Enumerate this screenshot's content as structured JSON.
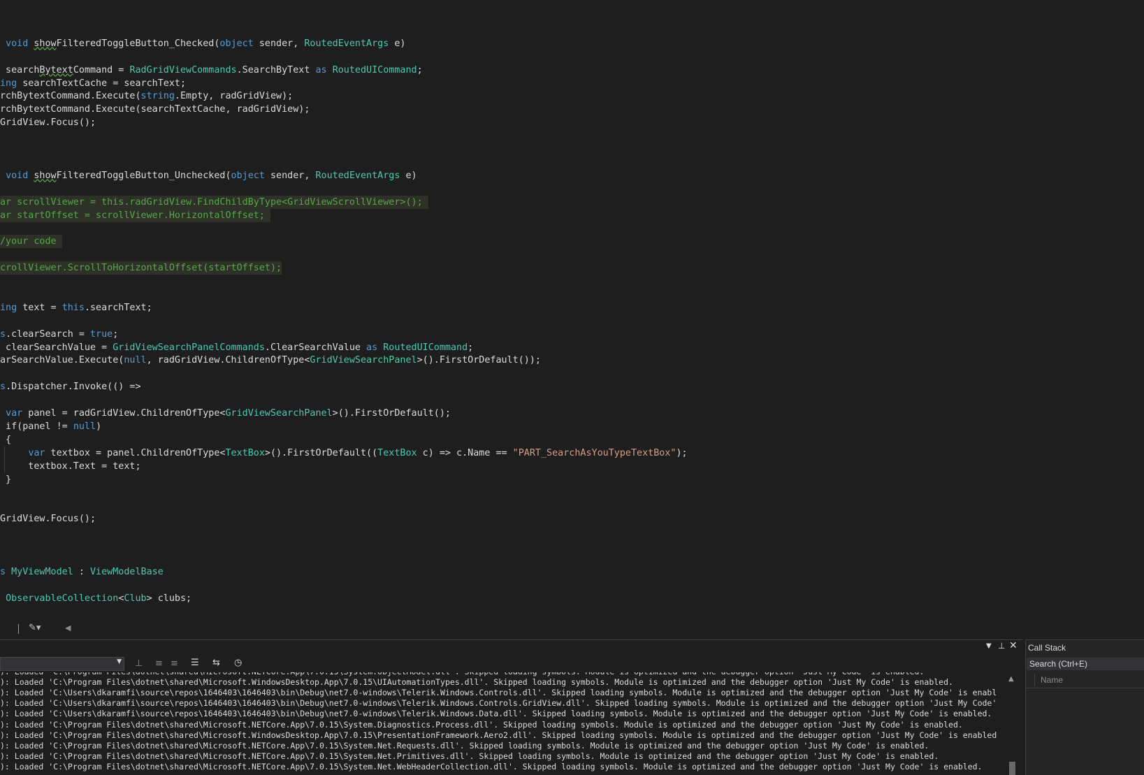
{
  "code_lines": [
    {
      "hl": false,
      "segs": []
    },
    {
      "hl": false,
      "segs": []
    },
    {
      "hl": false,
      "segs": [
        [
          "plain",
          " "
        ],
        [
          "kw",
          "void"
        ],
        [
          "plain",
          " "
        ],
        [
          "squig",
          "show"
        ],
        [
          "plain",
          "FilteredToggleButton_Checked("
        ],
        [
          "kw",
          "object"
        ],
        [
          "plain",
          " sender, "
        ],
        [
          "type",
          "RoutedEventArgs"
        ],
        [
          "plain",
          " e)"
        ]
      ]
    },
    {
      "hl": false,
      "segs": []
    },
    {
      "hl": false,
      "segs": [
        [
          "plain",
          " search"
        ],
        [
          "squig",
          "Bytext"
        ],
        [
          "plain",
          "Command = "
        ],
        [
          "type",
          "RadGridViewCommands"
        ],
        [
          "plain",
          ".SearchByText "
        ],
        [
          "kw",
          "as"
        ],
        [
          "plain",
          " "
        ],
        [
          "type",
          "RoutedUICommand"
        ],
        [
          "plain",
          ";"
        ]
      ]
    },
    {
      "hl": false,
      "segs": [
        [
          "kw",
          "ing"
        ],
        [
          "plain",
          " searchTextCache = searchText;"
        ]
      ]
    },
    {
      "hl": false,
      "segs": [
        [
          "plain",
          "rchBytextCommand.Execute("
        ],
        [
          "kw",
          "string"
        ],
        [
          "plain",
          ".Empty, radGridView);"
        ]
      ]
    },
    {
      "hl": false,
      "segs": [
        [
          "plain",
          "rchBytextCommand.Execute(searchTextCache, radGridView);"
        ]
      ]
    },
    {
      "hl": false,
      "segs": [
        [
          "plain",
          "GridView.Focus();"
        ]
      ]
    },
    {
      "hl": false,
      "segs": []
    },
    {
      "hl": false,
      "segs": []
    },
    {
      "hl": false,
      "segs": []
    },
    {
      "hl": false,
      "segs": [
        [
          "plain",
          " "
        ],
        [
          "kw",
          "void"
        ],
        [
          "plain",
          " "
        ],
        [
          "squig",
          "show"
        ],
        [
          "plain",
          "FilteredToggleButton_Unchecked("
        ],
        [
          "kw",
          "object"
        ],
        [
          "plain",
          " sender, "
        ],
        [
          "type",
          "RoutedEventArgs"
        ],
        [
          "plain",
          " e)"
        ]
      ]
    },
    {
      "hl": false,
      "segs": []
    },
    {
      "hl": true,
      "segs": [
        [
          "cm",
          "ar scrollViewer = this.radGridView.FindChildByType<GridViewScrollViewer>(); "
        ]
      ]
    },
    {
      "hl": true,
      "segs": [
        [
          "cm",
          "ar startOffset = scrollViewer.HorizontalOffset; "
        ]
      ]
    },
    {
      "hl": false,
      "segs": []
    },
    {
      "hl": true,
      "segs": [
        [
          "cm",
          "/your code "
        ]
      ]
    },
    {
      "hl": false,
      "segs": []
    },
    {
      "hl": true,
      "segs": [
        [
          "cm",
          "crollViewer.ScrollToHorizontalOffset(startOffset);"
        ]
      ]
    },
    {
      "hl": false,
      "segs": []
    },
    {
      "hl": false,
      "segs": []
    },
    {
      "hl": false,
      "segs": [
        [
          "kw",
          "ing"
        ],
        [
          "plain",
          " text = "
        ],
        [
          "kw",
          "this"
        ],
        [
          "plain",
          ".searchText;"
        ]
      ]
    },
    {
      "hl": false,
      "segs": []
    },
    {
      "hl": false,
      "segs": [
        [
          "kw",
          "s"
        ],
        [
          "plain",
          ".clearSearch = "
        ],
        [
          "kw",
          "true"
        ],
        [
          "plain",
          ";"
        ]
      ]
    },
    {
      "hl": false,
      "segs": [
        [
          "plain",
          " clearSearchValue = "
        ],
        [
          "type",
          "GridViewSearchPanelCommands"
        ],
        [
          "plain",
          ".ClearSearchValue "
        ],
        [
          "kw",
          "as"
        ],
        [
          "plain",
          " "
        ],
        [
          "type",
          "RoutedUICommand"
        ],
        [
          "plain",
          ";"
        ]
      ]
    },
    {
      "hl": false,
      "segs": [
        [
          "plain",
          "arSearchValue.Execute("
        ],
        [
          "kw",
          "null"
        ],
        [
          "plain",
          ", radGridView.ChildrenOfType<"
        ],
        [
          "type",
          "GridViewSearchPanel"
        ],
        [
          "plain",
          ">().FirstOrDefault());"
        ]
      ]
    },
    {
      "hl": false,
      "segs": []
    },
    {
      "hl": false,
      "segs": [
        [
          "kw",
          "s"
        ],
        [
          "plain",
          ".Dispatcher.Invoke(() =>"
        ]
      ]
    },
    {
      "hl": false,
      "segs": []
    },
    {
      "hl": false,
      "segs": [
        [
          "plain",
          " "
        ],
        [
          "kw",
          "var"
        ],
        [
          "plain",
          " panel = radGridView.ChildrenOfType<"
        ],
        [
          "type",
          "GridViewSearchPanel"
        ],
        [
          "plain",
          ">().FirstOrDefault();"
        ]
      ]
    },
    {
      "hl": false,
      "segs": [
        [
          "plain",
          " if(panel != "
        ],
        [
          "kw",
          "null"
        ],
        [
          "plain",
          ")"
        ]
      ]
    },
    {
      "hl": false,
      "segs": [
        [
          "plain",
          " {"
        ]
      ]
    },
    {
      "hl": false,
      "segs": [
        [
          "plain",
          "     "
        ],
        [
          "kw",
          "var"
        ],
        [
          "plain",
          " textbox = panel.ChildrenOfType<"
        ],
        [
          "type",
          "TextBox"
        ],
        [
          "plain",
          ">().FirstOrDefault(("
        ],
        [
          "type",
          "TextBox"
        ],
        [
          "plain",
          " c) => c.Name == "
        ],
        [
          "str",
          "\"PART_SearchAsYouTypeTextBox\""
        ],
        [
          "plain",
          ");"
        ]
      ]
    },
    {
      "hl": false,
      "segs": [
        [
          "plain",
          "     textbox.Text = text;"
        ]
      ]
    },
    {
      "hl": false,
      "segs": [
        [
          "plain",
          " }"
        ]
      ]
    },
    {
      "hl": false,
      "segs": []
    },
    {
      "hl": false,
      "segs": []
    },
    {
      "hl": false,
      "segs": [
        [
          "plain",
          "GridView.Focus();"
        ]
      ]
    },
    {
      "hl": false,
      "segs": []
    },
    {
      "hl": false,
      "segs": []
    },
    {
      "hl": false,
      "segs": []
    },
    {
      "hl": false,
      "segs": [
        [
          "kw",
          "s"
        ],
        [
          "plain",
          " "
        ],
        [
          "type",
          "MyViewModel"
        ],
        [
          "plain",
          " : "
        ],
        [
          "type",
          "ViewModelBase"
        ]
      ]
    },
    {
      "hl": false,
      "segs": []
    },
    {
      "hl": false,
      "segs": [
        [
          "plain",
          " "
        ],
        [
          "type",
          "ObservableCollection"
        ],
        [
          "plain",
          "<"
        ],
        [
          "type",
          "Club"
        ],
        [
          "plain",
          "> clubs;"
        ]
      ]
    }
  ],
  "output_lines": [
    "): Loaded 'C:\\Program Files\\dotnet\\shared\\Microsoft.NETCore.App\\7.0.15\\System.ObjectModel.dll'. Skipped loading symbols. Module is optimized and the debugger option 'Just My Code' is enabled.",
    "): Loaded 'C:\\Program Files\\dotnet\\shared\\Microsoft.WindowsDesktop.App\\7.0.15\\UIAutomationTypes.dll'. Skipped loading symbols. Module is optimized and the debugger option 'Just My Code' is enabled.",
    "): Loaded 'C:\\Users\\dkaramfi\\source\\repos\\1646403\\1646403\\bin\\Debug\\net7.0-windows\\Telerik.Windows.Controls.dll'. Skipped loading symbols. Module is optimized and the debugger option 'Just My Code' is enabl",
    "): Loaded 'C:\\Users\\dkaramfi\\source\\repos\\1646403\\1646403\\bin\\Debug\\net7.0-windows\\Telerik.Windows.Controls.GridView.dll'. Skipped loading symbols. Module is optimized and the debugger option 'Just My Code'",
    "): Loaded 'C:\\Users\\dkaramfi\\source\\repos\\1646403\\1646403\\bin\\Debug\\net7.0-windows\\Telerik.Windows.Data.dll'. Skipped loading symbols. Module is optimized and the debugger option 'Just My Code' is enabled.",
    "): Loaded 'C:\\Program Files\\dotnet\\shared\\Microsoft.NETCore.App\\7.0.15\\System.Diagnostics.Process.dll'. Skipped loading symbols. Module is optimized and the debugger option 'Just My Code' is enabled.",
    "): Loaded 'C:\\Program Files\\dotnet\\shared\\Microsoft.WindowsDesktop.App\\7.0.15\\PresentationFramework.Aero2.dll'. Skipped loading symbols. Module is optimized and the debugger option 'Just My Code' is enabled",
    "): Loaded 'C:\\Program Files\\dotnet\\shared\\Microsoft.NETCore.App\\7.0.15\\System.Net.Requests.dll'. Skipped loading symbols. Module is optimized and the debugger option 'Just My Code' is enabled.",
    "): Loaded 'C:\\Program Files\\dotnet\\shared\\Microsoft.NETCore.App\\7.0.15\\System.Net.Primitives.dll'. Skipped loading symbols. Module is optimized and the debugger option 'Just My Code' is enabled.",
    "): Loaded 'C:\\Program Files\\dotnet\\shared\\Microsoft.NETCore.App\\7.0.15\\System.Net.WebHeaderCollection.dll'. Skipped loading symbols. Module is optimized and the debugger option 'Just My Code' is enabled."
  ],
  "callstack": {
    "title": "Call Stack",
    "search_placeholder": "Search (Ctrl+E)",
    "column_name": "Name"
  },
  "icons": {
    "pin": "pin-icon",
    "dropdown": "chevron-down-icon",
    "close": "close-icon",
    "health": "brush-icon"
  },
  "colors": {
    "background": "#1e1e1e",
    "plain": "#dcdcdc",
    "kw": "#569cd6",
    "type": "#4ec9b0",
    "str": "#d69d85",
    "cm": "#57a64a",
    "highlight": "#2d3128"
  }
}
